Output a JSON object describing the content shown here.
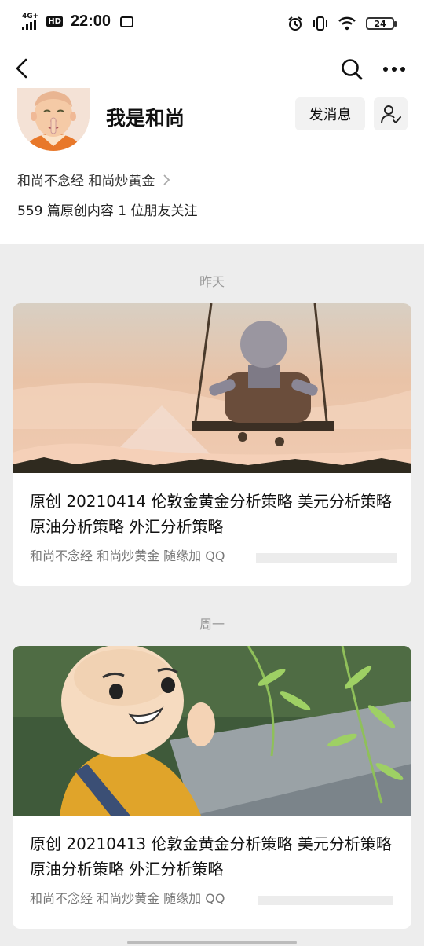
{
  "status_bar": {
    "network": "4G+",
    "hd": "HD",
    "time": "22:00",
    "battery": "24"
  },
  "profile": {
    "name": "我是和尚",
    "message_button": "发消息",
    "description": "和尚不念经 和尚炒黄金",
    "stats": "559 篇原创内容  1 位朋友关注"
  },
  "feed": [
    {
      "date": "昨天",
      "title": "原创 20210414 伦敦金黄金分析策略 美元分析策略 原油分析策略 外汇分析策略",
      "source": "和尚不念经 和尚炒黄金 随缘加 QQ"
    },
    {
      "date": "周一",
      "title": "原创 20210413 伦敦金黄金分析策略 美元分析策略 原油分析策略 外汇分析策略",
      "source": "和尚不念经 和尚炒黄金 随缘加 QQ"
    }
  ]
}
